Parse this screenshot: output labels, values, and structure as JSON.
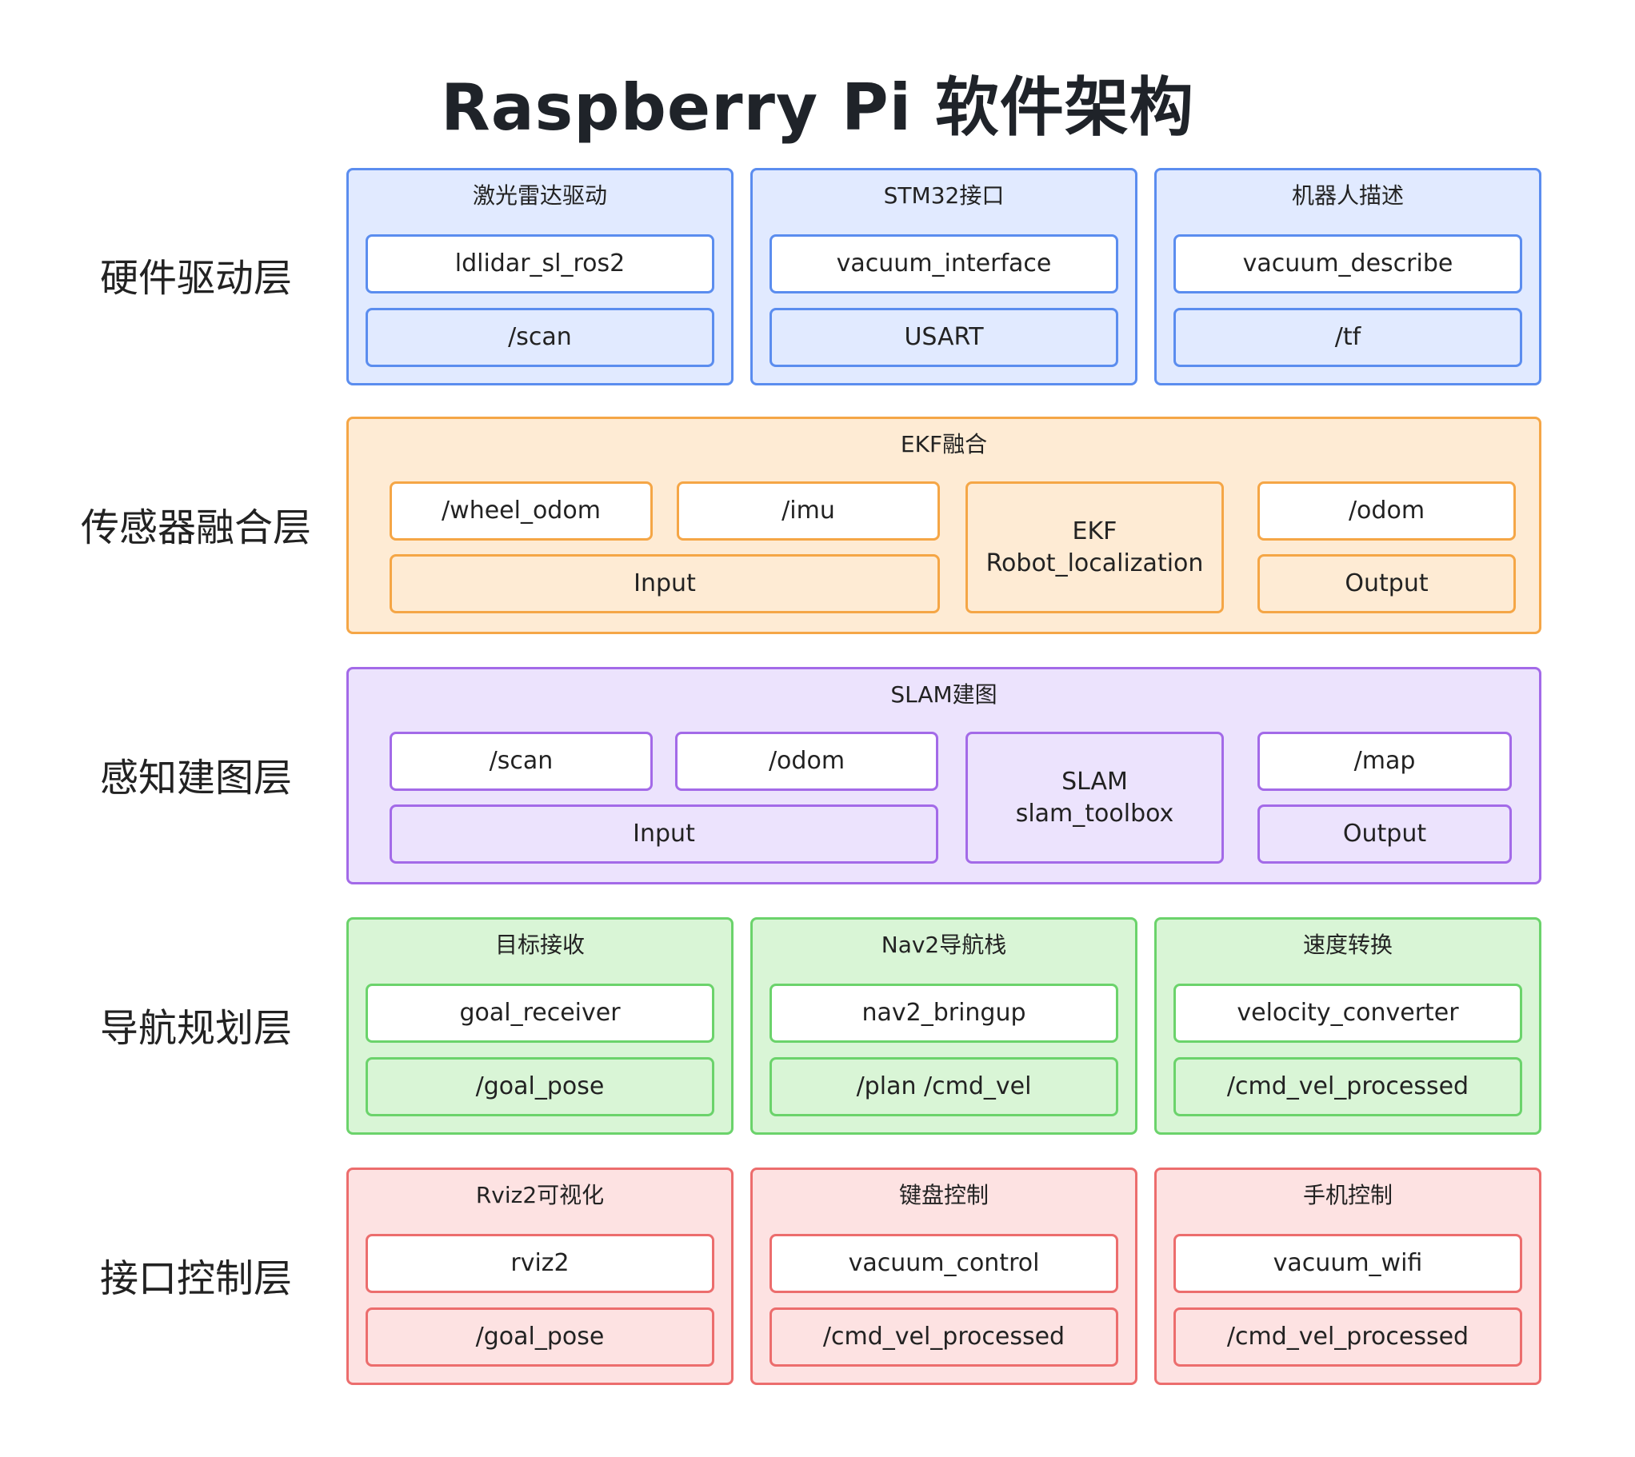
{
  "title": "Raspberry Pi 软件架构",
  "layers": {
    "hardware": {
      "label": "硬件驱动层",
      "panels": [
        {
          "title": "激光雷达驱动",
          "node": "ldlidar_sl_ros2",
          "topic": "/scan"
        },
        {
          "title": "STM32接口",
          "node": "vacuum_interface",
          "topic": "USART"
        },
        {
          "title": "机器人描述",
          "node": "vacuum_describe",
          "topic": "/tf"
        }
      ]
    },
    "fusion": {
      "label": "传感器融合层",
      "panel_title": "EKF融合",
      "inputs": [
        "/wheel_odom",
        "/imu"
      ],
      "input_label": "Input",
      "core_line1": "EKF",
      "core_line2": "Robot_localization",
      "output": "/odom",
      "output_label": "Output"
    },
    "slam": {
      "label": "感知建图层",
      "panel_title": "SLAM建图",
      "inputs": [
        "/scan",
        "/odom"
      ],
      "input_label": "Input",
      "core_line1": "SLAM",
      "core_line2": "slam_toolbox",
      "output": "/map",
      "output_label": "Output"
    },
    "navigation": {
      "label": "导航规划层",
      "panels": [
        {
          "title": "目标接收",
          "node": "goal_receiver",
          "topic": "/goal_pose"
        },
        {
          "title": "Nav2导航栈",
          "node": "nav2_bringup",
          "topic": "/plan /cmd_vel"
        },
        {
          "title": "速度转换",
          "node": "velocity_converter",
          "topic": "/cmd_vel_processed"
        }
      ]
    },
    "interface": {
      "label": "接口控制层",
      "panels": [
        {
          "title": "Rviz2可视化",
          "node": "rviz2",
          "topic": "/goal_pose"
        },
        {
          "title": "键盘控制",
          "node": "vacuum_control",
          "topic": "/cmd_vel_processed"
        },
        {
          "title": "手机控制",
          "node": "vacuum_wifi",
          "topic": "/cmd_vel_processed"
        }
      ]
    }
  },
  "colors": {
    "blue": "#5b8def",
    "orange": "#f5a646",
    "purple": "#a36ae8",
    "green": "#6bd36b",
    "red": "#ec6d6d"
  }
}
